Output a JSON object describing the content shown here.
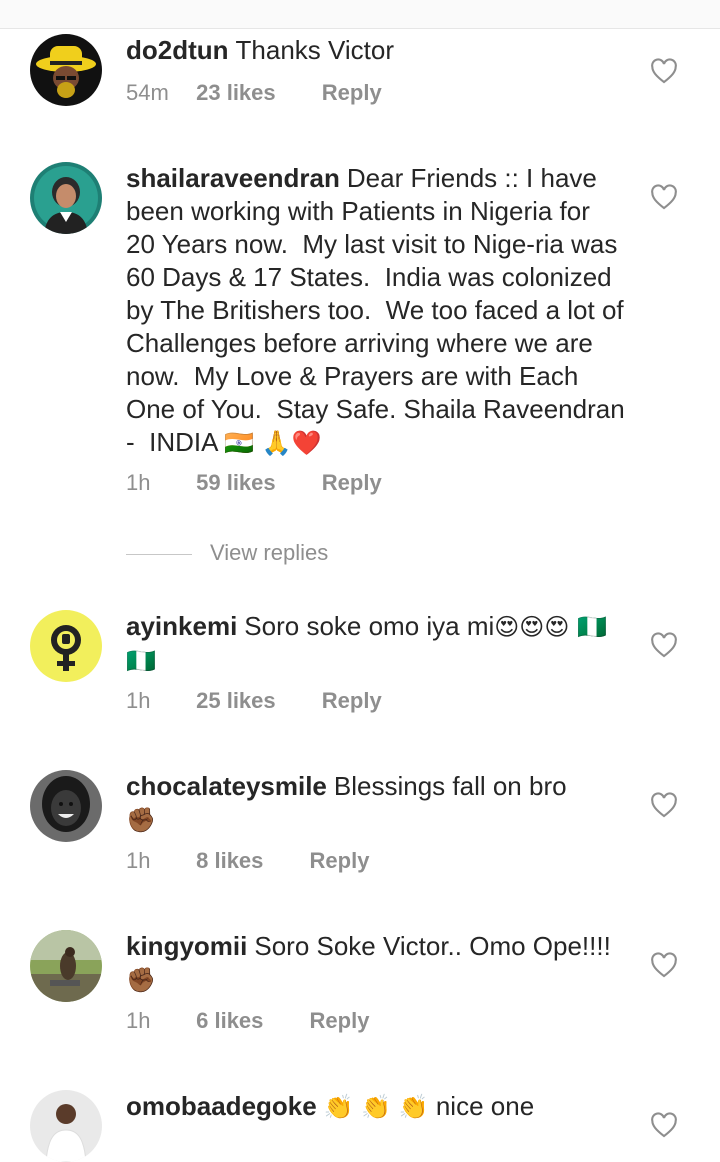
{
  "comments": [
    {
      "username": "do2dtun",
      "text": "Thanks Victor",
      "time": "54m",
      "likes": "23 likes",
      "reply": "Reply",
      "avatar_icon": "avatar-yellow-hat-man"
    },
    {
      "username": "shailaraveendran",
      "text": "Dear Friends :: I have been working with Patients in Nigeria for 20 Years now.  My last visit to Nige-ria was 60 Days & 17 States.  India was colonized by The Britishers too.  We too faced a lot of Challenges before arriving where we are now.  My Love & Prayers are with Each One of You.  Stay Safe. Shaila Raveendran -  INDIA ",
      "emoji": "🇮🇳 🙏❤️",
      "time": "1h",
      "likes": "59 likes",
      "reply": "Reply",
      "avatar_icon": "avatar-woman-portrait"
    },
    {
      "username": "ayinkemi",
      "text": "Soro soke omo iya mi",
      "emoji": "😍😍😍 🇳🇬🇳🇬",
      "time": "1h",
      "likes": "25 likes",
      "reply": "Reply",
      "avatar_icon": "avatar-female-symbol-fist"
    },
    {
      "username": "chocalateysmile",
      "text": "Blessings fall on bro",
      "emoji": "✊🏾",
      "time": "1h",
      "likes": "8 likes",
      "reply": "Reply",
      "avatar_icon": "avatar-smiling-woman"
    },
    {
      "username": "kingyomii",
      "text": "Soro Soke Victor.. Omo Ope!!!! ",
      "emoji": "✊🏾",
      "time": "1h",
      "likes": "6 likes",
      "reply": "Reply",
      "avatar_icon": "avatar-outdoor-photo"
    },
    {
      "username": "omobaadegoke",
      "emoji": "👏 👏 👏",
      "text": " nice one",
      "avatar_icon": "avatar-man-portrait"
    }
  ],
  "view_replies": "View replies",
  "colors": {
    "text": "#262626",
    "muted": "#8e8e8e",
    "topbar": "#fafafa"
  }
}
